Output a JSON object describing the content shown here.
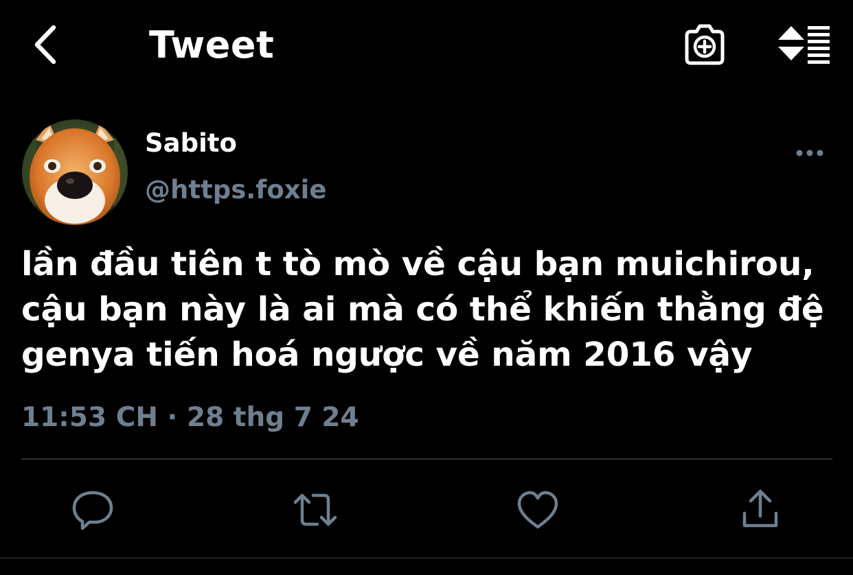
{
  "header": {
    "back_icon": "chevron-left-icon",
    "title": "Tweet",
    "camera_icon": "camera-plus-icon",
    "sort_icon": "sort-toggle-icon"
  },
  "tweet": {
    "display_name": "Sabito",
    "handle": "@https.foxie",
    "avatar": "fox-photo",
    "more_icon": "ellipsis-icon",
    "text": "lần đầu tiên t tò mò về cậu bạn muichirou,\ncậu bạn này là ai mà có thể khiến thằng đệ\ngenya tiến hoá ngược về năm 2016 vậy",
    "timestamp": "11:53 CH · 28 thg 7 24"
  },
  "actions": {
    "reply_icon": "reply-icon",
    "retweet_icon": "retweet-icon",
    "like_icon": "heart-icon",
    "share_icon": "share-icon"
  },
  "colors": {
    "background": "#000000",
    "text": "#ffffff",
    "secondary": "#6e7f90",
    "icon": "#6e7f90",
    "divider": "#2f3336"
  }
}
